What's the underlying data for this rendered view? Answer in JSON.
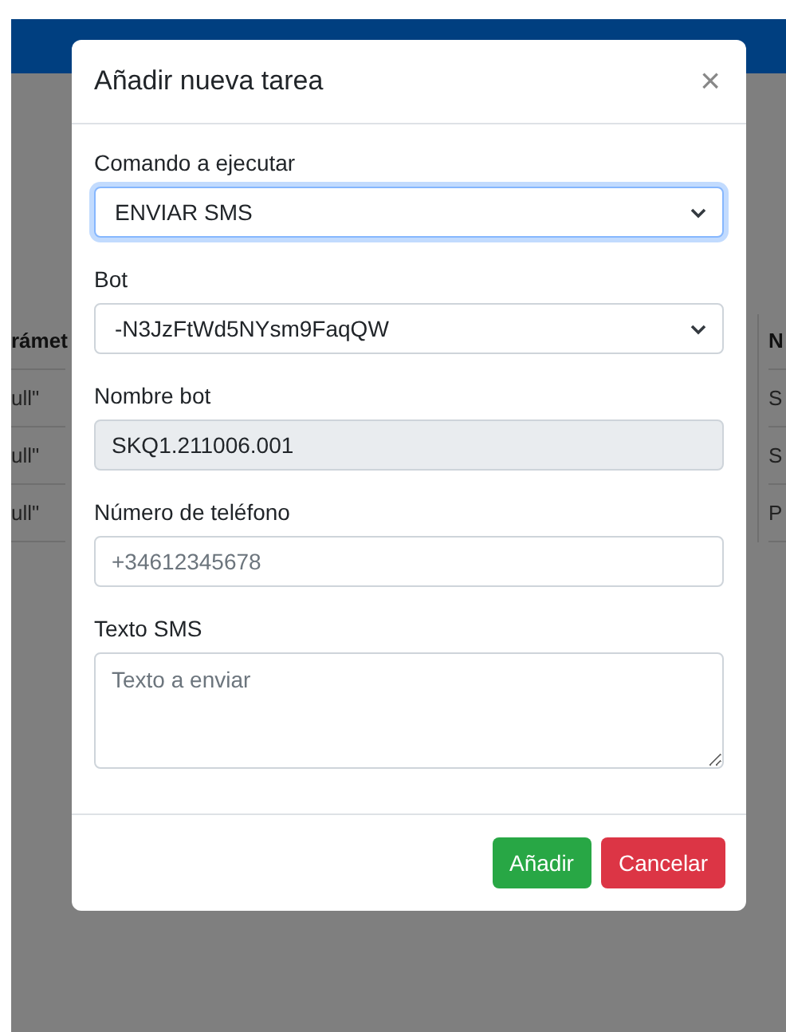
{
  "background_table": {
    "columns": [
      {
        "header": "rámet",
        "cells": [
          "ull\"",
          "ull\"",
          "ull\""
        ]
      },
      {
        "header": "N",
        "cells": [
          "S",
          "S",
          "P"
        ]
      }
    ]
  },
  "dialog": {
    "title": "Añadir nueva tarea",
    "close": "×",
    "fields": [
      {
        "kind": "select",
        "label": "Comando a ejecutar",
        "value": "ENVIAR SMS",
        "focused": true,
        "disabled": false
      },
      {
        "kind": "select",
        "label": "Bot",
        "value": "-N3JzFtWd5NYsm9FaqQW",
        "focused": false,
        "disabled": false
      },
      {
        "kind": "input",
        "label": "Nombre bot",
        "value": "SKQ1.211006.001",
        "focused": false,
        "disabled": true
      },
      {
        "kind": "input",
        "label": "Número de teléfono",
        "placeholder": "+34612345678",
        "focused": false,
        "disabled": false
      },
      {
        "kind": "textarea",
        "label": "Texto SMS",
        "placeholder": "Texto a enviar",
        "focused": false,
        "disabled": false
      }
    ],
    "buttons": [
      {
        "kind": "success",
        "label": "Añadir"
      },
      {
        "kind": "danger",
        "label": "Cancelar"
      }
    ]
  }
}
